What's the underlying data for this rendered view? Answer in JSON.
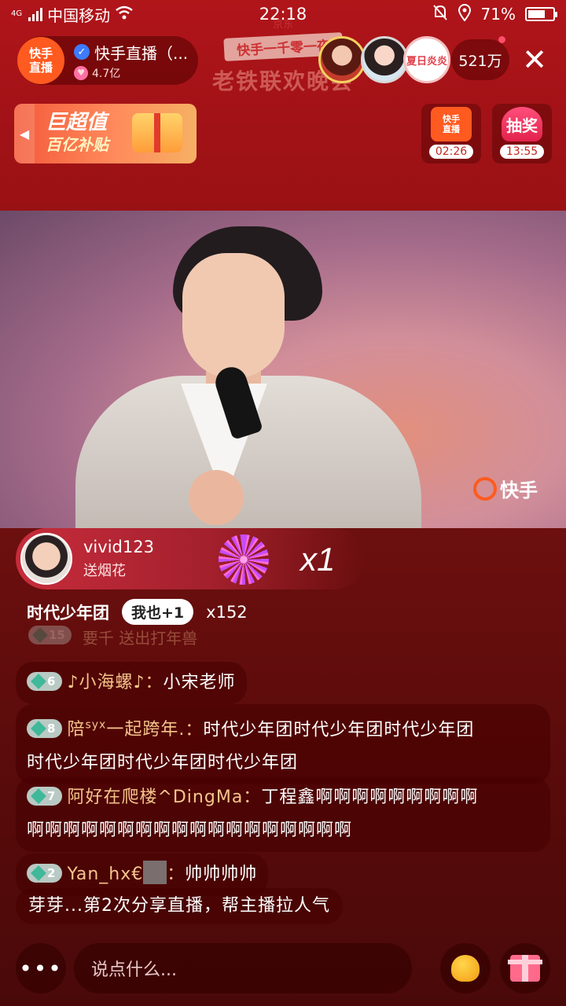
{
  "status_bar": {
    "network": "4G",
    "carrier": "中国移动",
    "time": "22:18",
    "battery": "71%",
    "battery_level": 0.71
  },
  "header": {
    "host_logo_line1": "快手",
    "host_logo_line2": "直播",
    "host_name": "快手直播（...",
    "host_likes": "4.7亿",
    "event_sponsor": "京东",
    "event_subtitle": "快手一千零一夜",
    "event_title": "老铁联欢晚会",
    "viewer_3_label": "夏日炎炎",
    "viewer_count": "521万"
  },
  "promo": {
    "line1": "巨超值",
    "line2": "百亿补贴"
  },
  "widgets": {
    "live_line1": "快手",
    "live_line2": "直播",
    "live_timer": "02:26",
    "lottery_label": "抽奖",
    "lottery_timer": "13:55"
  },
  "video": {
    "watermark": "快手"
  },
  "gift_banner": {
    "user": "vivid123",
    "action": "送烟花",
    "count": "x1"
  },
  "group": {
    "name": "时代少年团",
    "button_prefix": "我也",
    "button_suffix": "+1",
    "count": "x152"
  },
  "comments": {
    "faded": {
      "level": "15",
      "text": "要千 送出打年兽"
    },
    "items": [
      {
        "level": "6",
        "user": "♪小海螺♪",
        "sep": "：",
        "text": "小宋老师"
      },
      {
        "level": "8",
        "user_prefix": "陪",
        "user_sup": "syx",
        "user_suffix": "一起跨年.",
        "sep": "：",
        "text_line1": "时代少年团时代少年团时代少年团",
        "text_line2": "时代少年团时代少年团时代少年团"
      },
      {
        "level": "7",
        "user": "阿好在爬楼^DingMa",
        "sep": "：",
        "text_line1": "丁程鑫啊啊啊啊啊啊啊啊啊",
        "text_line2": "啊啊啊啊啊啊啊啊啊啊啊啊啊啊啊啊啊啊"
      },
      {
        "level": "2",
        "user": "Yan_hx€",
        "sep": "：",
        "text": "帅帅帅帅"
      }
    ],
    "share": "芽芽...第2次分享直播，帮主播拉人气"
  },
  "bottom_bar": {
    "more": "•••",
    "input_placeholder": "说点什么..."
  }
}
